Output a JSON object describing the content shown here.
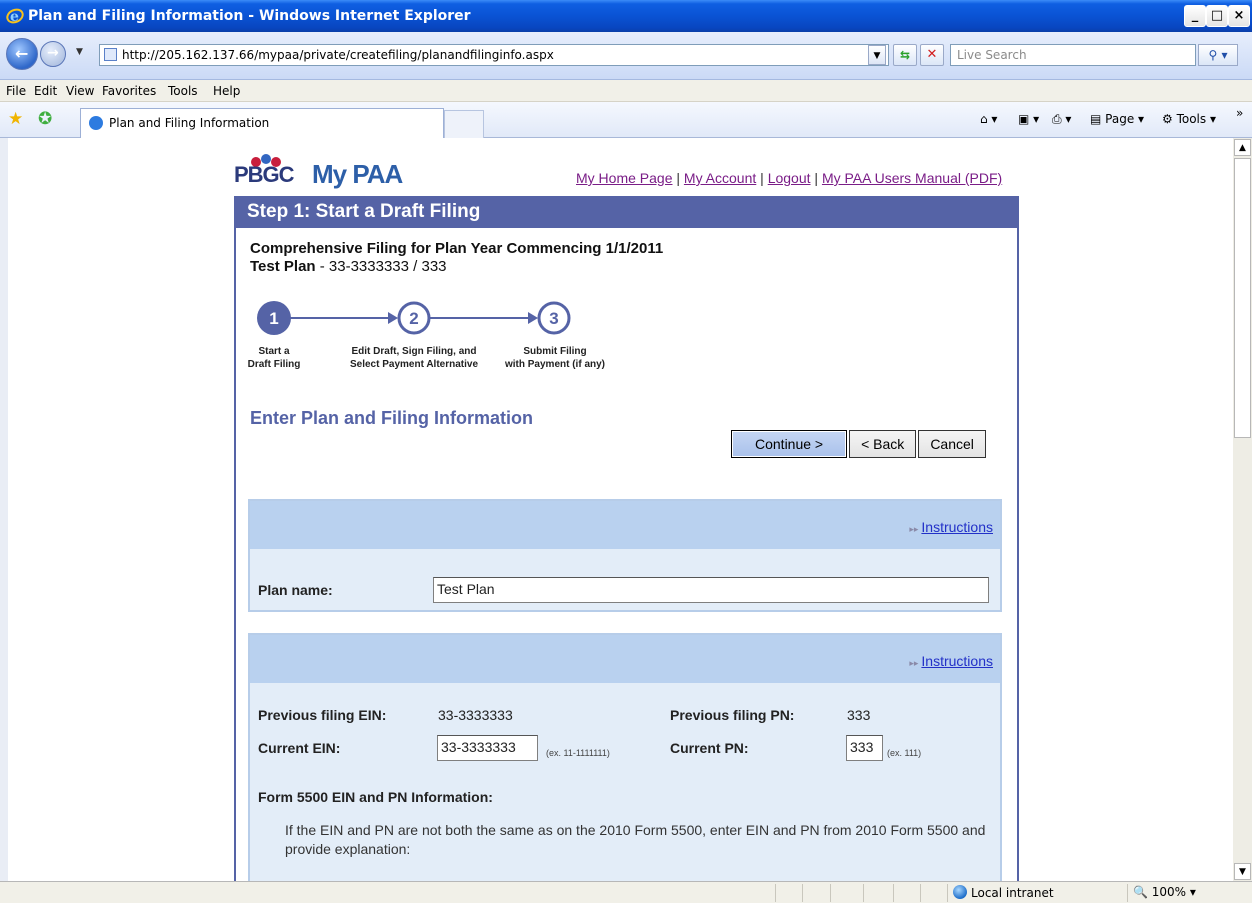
{
  "window": {
    "title": "Plan and Filing Information - Windows Internet Explorer",
    "min": "_",
    "max": "□",
    "close": "×"
  },
  "address": {
    "url": "http://205.162.137.66/mypaa/private/createfiling/planandfilinginfo.aspx",
    "search_placeholder": "Live Search"
  },
  "menu": [
    "File",
    "Edit",
    "View",
    "Favorites",
    "Tools",
    "Help"
  ],
  "tabs": {
    "active": "Plan and Filing Information"
  },
  "commandbar": {
    "page": "Page",
    "tools": "Tools"
  },
  "header": {
    "logo_pbgc": "PBGC",
    "logo_mypaa": "My PAA",
    "links": [
      "My Home Page",
      "My Account",
      "Logout",
      "My PAA Users Manual (PDF)"
    ],
    "separator": "|"
  },
  "step_title": "Step 1: Start a Draft Filing",
  "filing": {
    "heading": "Comprehensive Filing for Plan Year Commencing 1/1/2011",
    "plan_bold": "Test Plan",
    "plan_rest": " - 33-3333333 / 333"
  },
  "stepper": {
    "steps": [
      {
        "num": "1",
        "line1": "Start a",
        "line2": "Draft Filing"
      },
      {
        "num": "2",
        "line1": "Edit Draft, Sign Filing, and",
        "line2": "Select Payment Alternative"
      },
      {
        "num": "3",
        "line1": "Submit Filing",
        "line2": "with Payment (if any)"
      }
    ],
    "current": 1
  },
  "section_title": "Enter Plan and Filing Information",
  "buttons": {
    "continue": "Continue >",
    "back": "< Back",
    "cancel": "Cancel"
  },
  "panel1": {
    "instructions": "Instructions",
    "plan_name_label": "Plan name:",
    "plan_name_value": "Test Plan"
  },
  "panel2": {
    "instructions": "Instructions",
    "prev_ein_label": "Previous filing EIN:",
    "prev_ein_value": "33-3333333",
    "prev_pn_label": "Previous filing PN:",
    "prev_pn_value": "333",
    "cur_ein_label": "Current EIN:",
    "cur_ein_value": "33-3333333",
    "cur_ein_hint": "(ex. 11-1111111)",
    "cur_pn_label": "Current PN:",
    "cur_pn_value": "333",
    "cur_pn_hint": "(ex. 111)",
    "form_heading": "Form 5500 EIN and PN Information:",
    "form_text": "If the EIN and PN are not both the same as on the 2010 Form 5500, enter EIN and PN from 2010 Form 5500 and provide explanation:"
  },
  "status": {
    "zone": "Local intranet",
    "zoom": "100%"
  },
  "colors": {
    "titlebar": "#0a53d4",
    "step_bar": "#5563a6",
    "panel_bg": "#e3edf8",
    "panel_head": "#b9d1ef",
    "link_visited": "#7a1d87",
    "link": "#2230c8"
  }
}
